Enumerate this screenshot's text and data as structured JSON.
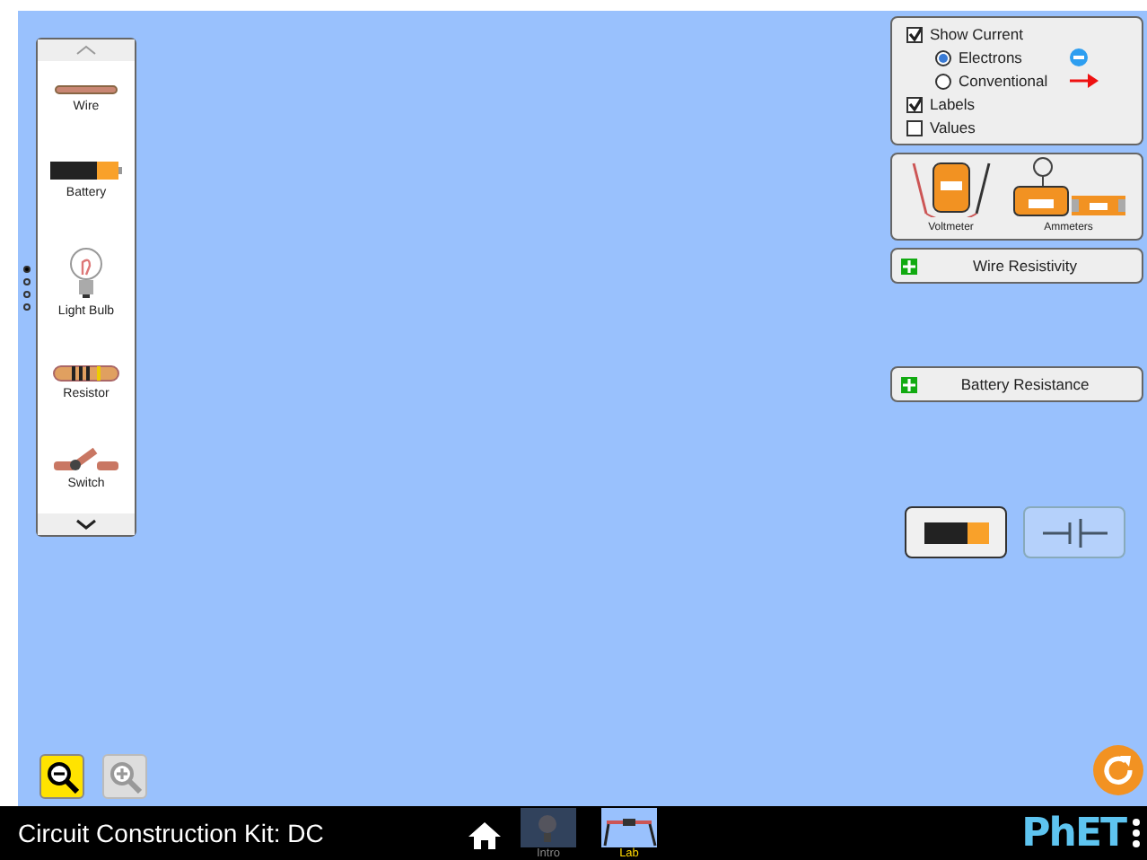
{
  "toolbox": {
    "items": [
      {
        "label": "Wire",
        "kind": "wire"
      },
      {
        "label": "Battery",
        "kind": "battery"
      },
      {
        "label": "Light Bulb",
        "kind": "bulb"
      },
      {
        "label": "Resistor",
        "kind": "resistor"
      },
      {
        "label": "Switch",
        "kind": "switch"
      }
    ],
    "page_dots": [
      {
        "selected": true
      },
      {
        "selected": false
      },
      {
        "selected": false
      },
      {
        "selected": false
      }
    ]
  },
  "display_panel": {
    "show_current": {
      "label": "Show Current",
      "checked": true
    },
    "current_types": [
      {
        "label": "Electrons",
        "selected": true,
        "kind": "electron"
      },
      {
        "label": "Conventional",
        "selected": false,
        "kind": "arrow"
      }
    ],
    "options": [
      {
        "label": "Labels",
        "checked": true
      },
      {
        "label": "Values",
        "checked": false
      }
    ]
  },
  "meters": [
    {
      "label": "Voltmeter",
      "kind": "voltmeter"
    },
    {
      "label": "Ammeters",
      "kind": "ammeter"
    }
  ],
  "accordions": [
    {
      "label": "Wire Resistivity",
      "expanded": false
    },
    {
      "label": "Battery Resistance",
      "expanded": false
    }
  ],
  "view_toggle": [
    {
      "kind": "lifelike",
      "selected": true
    },
    {
      "kind": "schematic",
      "selected": false
    }
  ],
  "zoom": [
    {
      "kind": "out",
      "disabled": false
    },
    {
      "kind": "in",
      "disabled": true
    }
  ],
  "sim_title": "Circuit Construction Kit: DC",
  "screens": [
    {
      "label": "Intro",
      "kind": "intro",
      "selected": false
    },
    {
      "label": "Lab",
      "kind": "lab",
      "selected": true
    }
  ],
  "brand": "PhET"
}
